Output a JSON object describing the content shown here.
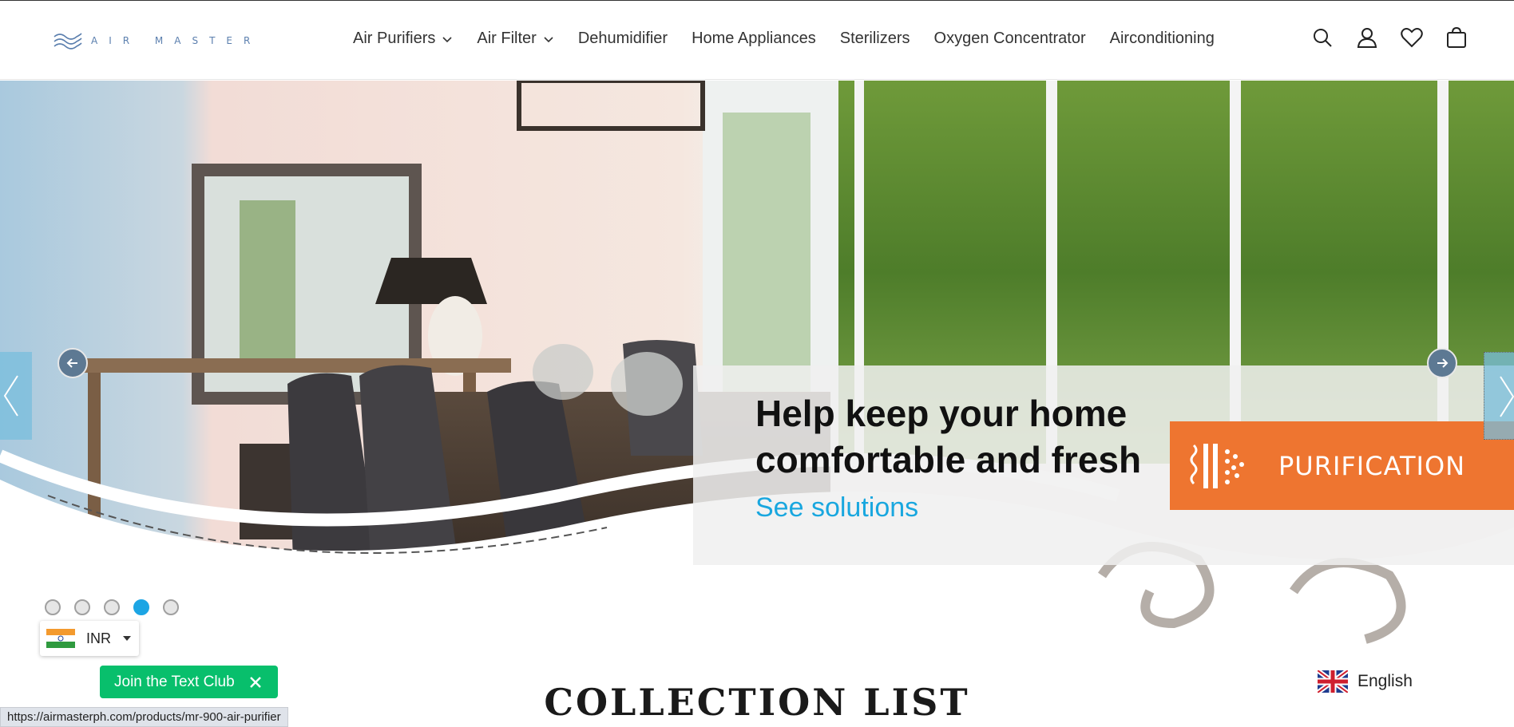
{
  "brand": {
    "logo_text": "AIR MASTER"
  },
  "nav": {
    "items": [
      {
        "label": "Air Purifiers",
        "has_dropdown": true
      },
      {
        "label": "Air Filter",
        "has_dropdown": true
      },
      {
        "label": "Dehumidifier",
        "has_dropdown": false
      },
      {
        "label": "Home Appliances",
        "has_dropdown": false
      },
      {
        "label": "Sterilizers",
        "has_dropdown": false
      },
      {
        "label": "Oxygen Concentrator",
        "has_dropdown": false
      },
      {
        "label": "Airconditioning",
        "has_dropdown": false
      }
    ]
  },
  "header_icons": [
    "search-icon",
    "account-icon",
    "wishlist-icon",
    "cart-icon"
  ],
  "hero": {
    "heading_line1": "Help keep your home",
    "heading_line2": "comfortable and fresh",
    "link": "See solutions",
    "tag": "PURIFICATION",
    "slides_total": 5,
    "active_slide": 4
  },
  "currency": {
    "code": "INR",
    "flag": "india-flag-icon"
  },
  "text_club": {
    "label": "Join the Text Club"
  },
  "section": {
    "title": "COLLECTION LIST"
  },
  "language": {
    "label": "English",
    "flag": "uk-flag-icon"
  },
  "status_url": "https://airmasterph.com/products/mr-900-air-purifier",
  "colors": {
    "accent_blue": "#19a7df",
    "purification_orange": "#ee7530",
    "text_club_green": "#08bf6c"
  }
}
